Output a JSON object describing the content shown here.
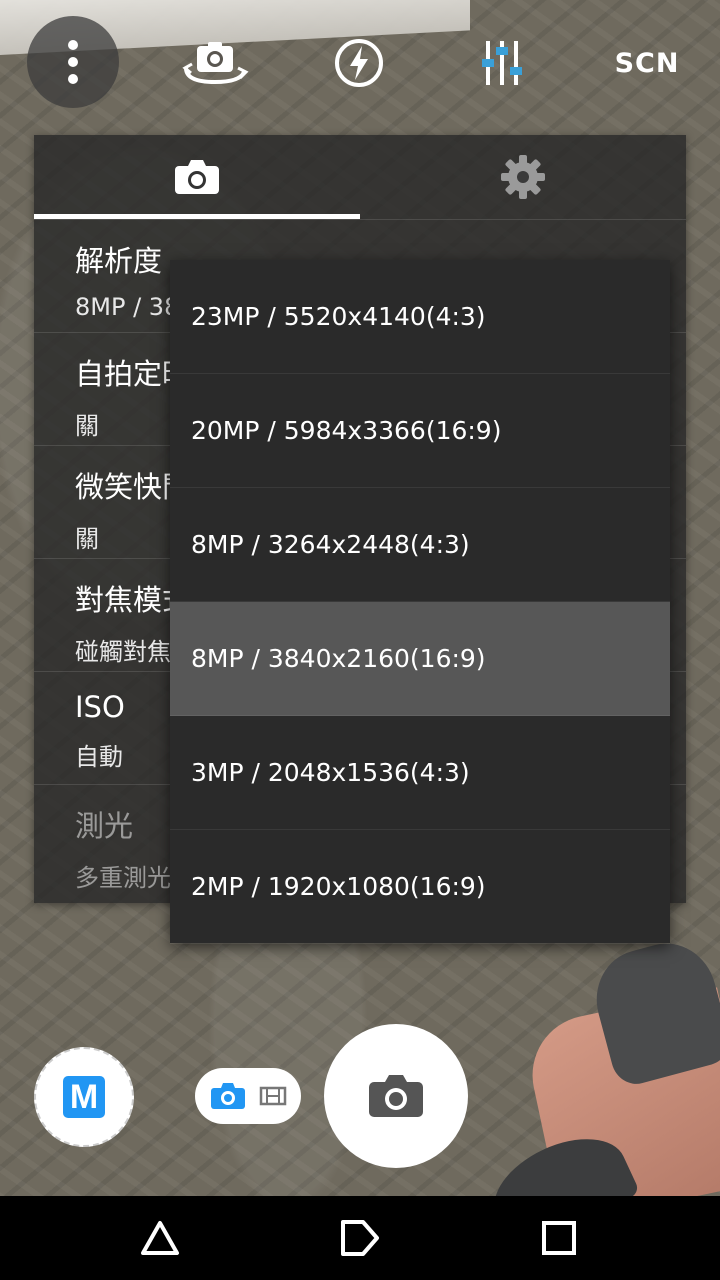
{
  "toolbar": {
    "scene_label": "SCN",
    "icons": [
      "overflow-menu-icon",
      "switch-camera-icon",
      "flash-auto-icon",
      "adjustments-icon"
    ]
  },
  "panel": {
    "tabs": [
      {
        "icon": "camera-icon",
        "active": true
      },
      {
        "icon": "gear-icon",
        "active": false
      }
    ],
    "settings": [
      {
        "name": "解析度",
        "value": "8MP / 3840x2160(16:9)"
      },
      {
        "name": "自拍定時器",
        "value": "關"
      },
      {
        "name": "微笑快門",
        "value": "關"
      },
      {
        "name": "對焦模式",
        "value": "碰觸對焦"
      },
      {
        "name": "ISO",
        "value": "自動"
      },
      {
        "name": "測光",
        "value": "多重測光"
      }
    ]
  },
  "resolution_menu": {
    "options": [
      "23MP / 5520x4140(4:3)",
      "20MP / 5984x3366(16:9)",
      "8MP / 3264x2448(4:3)",
      "8MP / 3840x2160(16:9)",
      "3MP / 2048x1536(4:3)",
      "2MP / 1920x1080(16:9)"
    ],
    "selected_index": 3
  },
  "bottom": {
    "mode_label": "M",
    "accent_color": "#2196f3"
  }
}
